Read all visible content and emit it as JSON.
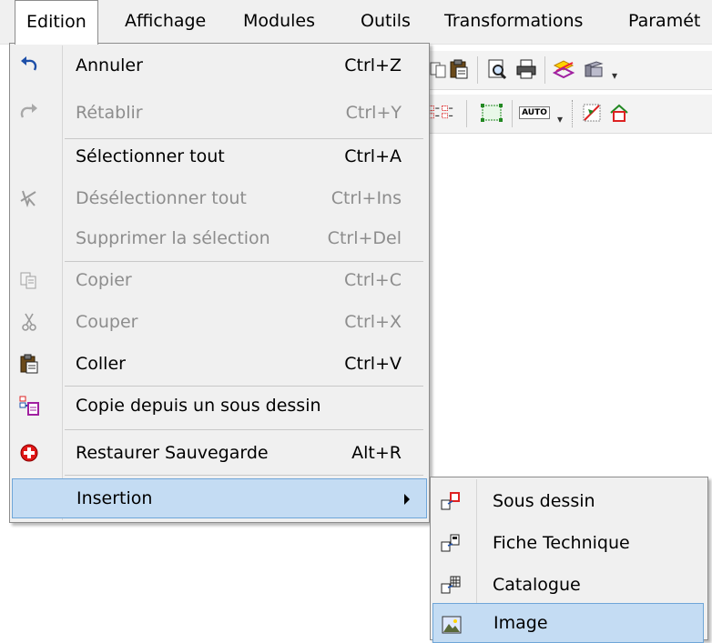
{
  "menubar": {
    "items": [
      {
        "label": "Edition"
      },
      {
        "label": "Affichage"
      },
      {
        "label": "Modules"
      },
      {
        "label": "Outils"
      },
      {
        "label": "Transformations"
      },
      {
        "label": "Paramét"
      }
    ]
  },
  "toolbar": {
    "auto_label": "AUTO",
    "icons": [
      "copy-icon",
      "paste-icon",
      "print-preview-icon",
      "print-icon",
      "layers-icon",
      "table-icon",
      "align-icon",
      "frame-icon",
      "auto-icon",
      "select-icon",
      "home-icon"
    ]
  },
  "edit_menu": {
    "items": [
      {
        "label": "Annuler",
        "shortcut": "Ctrl+Z",
        "enabled": true,
        "icon": "undo-icon"
      },
      {
        "label": "Rétablir",
        "shortcut": "Ctrl+Y",
        "enabled": false,
        "icon": "redo-icon"
      },
      {
        "label": "Sélectionner tout",
        "shortcut": "Ctrl+A",
        "enabled": true
      },
      {
        "label": "Désélectionner tout",
        "shortcut": "Ctrl+Ins",
        "enabled": false,
        "icon": "deselect-icon"
      },
      {
        "label": "Supprimer la sélection",
        "shortcut": "Ctrl+Del",
        "enabled": false
      },
      {
        "label": "Copier",
        "shortcut": "Ctrl+C",
        "enabled": false,
        "icon": "copy-icon"
      },
      {
        "label": "Couper",
        "shortcut": "Ctrl+X",
        "enabled": false,
        "icon": "scissors-icon"
      },
      {
        "label": "Coller",
        "shortcut": "Ctrl+V",
        "enabled": true,
        "icon": "paste-icon"
      },
      {
        "label": "Copie depuis un sous dessin",
        "shortcut": "",
        "enabled": true,
        "icon": "copy-from-subdrawing-icon"
      },
      {
        "label": "Restaurer Sauvegarde",
        "shortcut": "Alt+R",
        "enabled": true,
        "icon": "restore-icon"
      },
      {
        "label": "Insertion",
        "shortcut": "",
        "enabled": true,
        "highlighted": true,
        "has_submenu": true
      }
    ]
  },
  "insertion_submenu": {
    "items": [
      {
        "label": "Sous dessin",
        "icon": "subdrawing-icon"
      },
      {
        "label": "Fiche Technique",
        "icon": "datasheet-icon"
      },
      {
        "label": "Catalogue",
        "icon": "catalog-icon"
      },
      {
        "label": "Image",
        "icon": "image-icon",
        "highlighted": true
      }
    ]
  },
  "colors": {
    "menu_bg": "#f0f0f0",
    "highlight_bg": "#c4dcf3",
    "highlight_border": "#6fa6d8",
    "disabled_text": "#8d8d8d"
  }
}
